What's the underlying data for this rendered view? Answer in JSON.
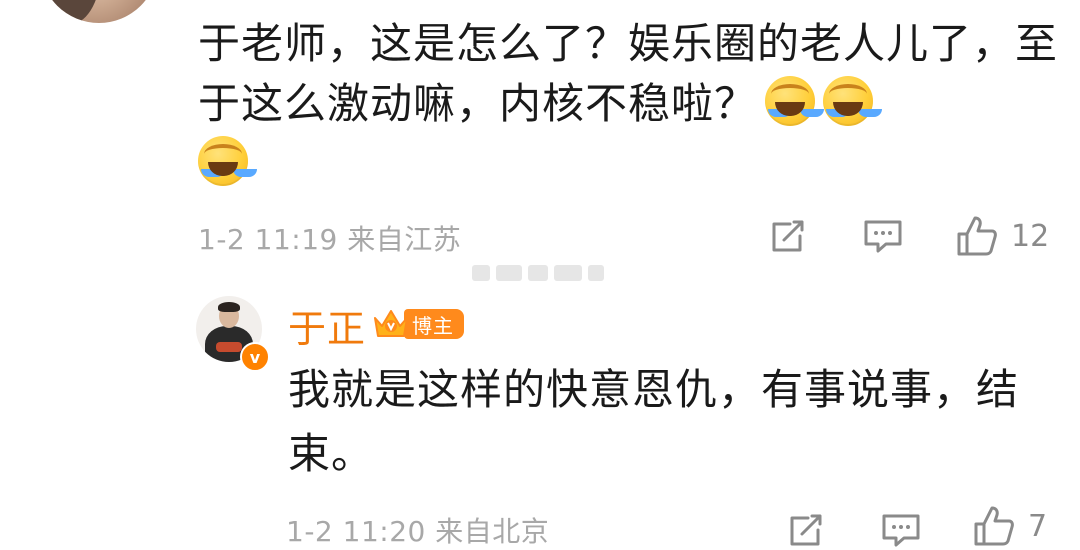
{
  "comment": {
    "text": "于老师，这是怎么了？娱乐圈的老人儿了，至于这么激动嘛，内核不稳啦？",
    "emojis": [
      "laugh-cry-icon",
      "laugh-cry-icon",
      "laugh-cry-icon"
    ],
    "meta": "1-2 11:19 来自江苏",
    "like_count": "12"
  },
  "reply": {
    "author": "于正",
    "badge": "博主",
    "text": "我就是这样的快意恩仇，有事说事，结束。",
    "meta": "1-2 11:20 来自北京",
    "like_count": "7"
  },
  "colors": {
    "author_name": "#f07a0c",
    "badge_bg": "#ff8a1c",
    "meta_text": "#a8a8a8",
    "icon": "#8a8a8a"
  }
}
